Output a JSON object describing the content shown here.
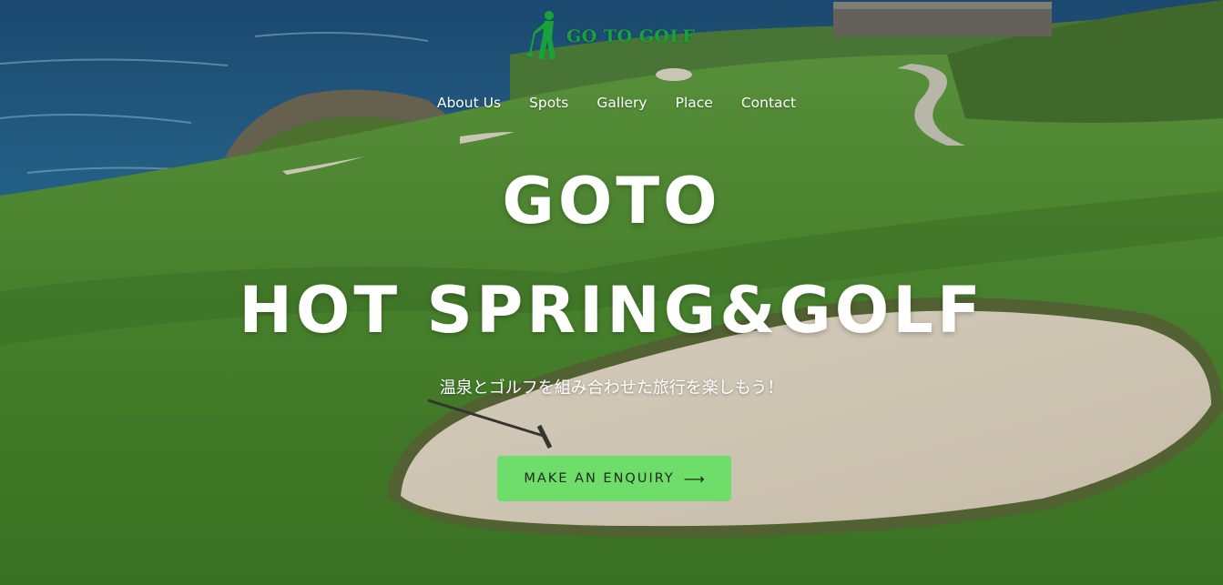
{
  "logo": {
    "text": "GO TO GOLF",
    "icon": "golfer-icon",
    "color": "#17a23a"
  },
  "nav": {
    "items": [
      {
        "label": "About Us"
      },
      {
        "label": "Spots"
      },
      {
        "label": "Gallery"
      },
      {
        "label": "Place"
      },
      {
        "label": "Contact"
      }
    ]
  },
  "hero": {
    "title_line1": "GOTO",
    "title_line2": "HOT SPRING&GOLF",
    "subtitle": "温泉とゴルフを組み合わせた旅行を楽しもう！",
    "cta_label": "MAKE AN ENQUIRY",
    "cta_icon": "arrow-right-icon",
    "cta_color": "#6fdd6a"
  }
}
